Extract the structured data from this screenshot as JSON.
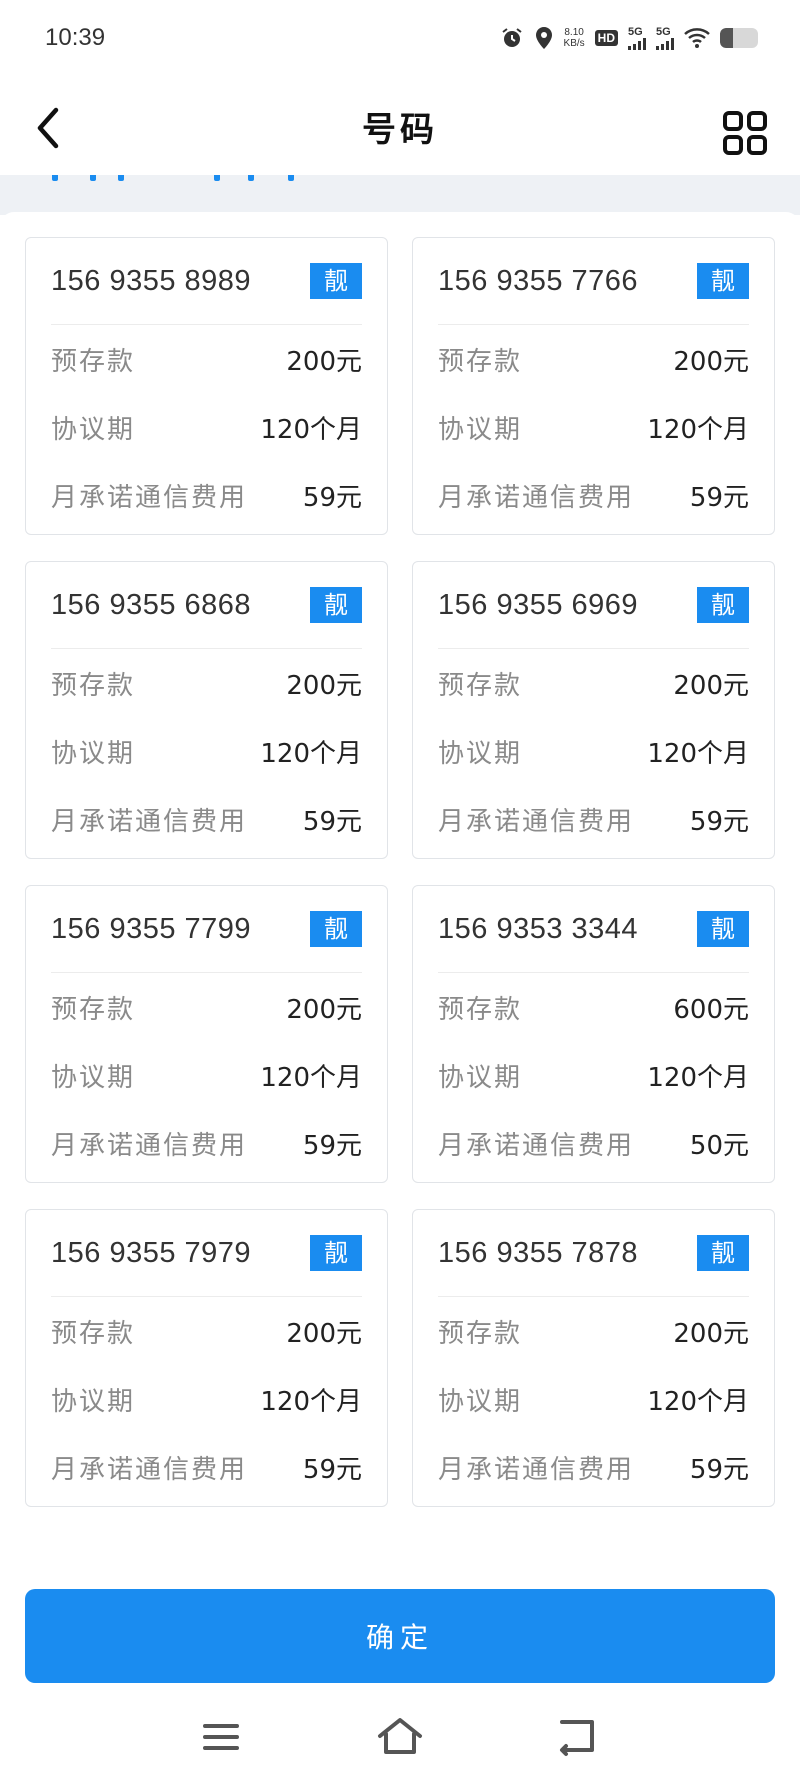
{
  "status_bar": {
    "time": "10:39",
    "net_speed_value": "8.10",
    "net_speed_unit": "KB/s",
    "hd_label": "HD",
    "signal1_label": "5G",
    "signal2_label": "5G",
    "battery_level": 0.35,
    "icons": [
      "alarm-icon",
      "location-icon",
      "wifi-icon",
      "battery-icon"
    ]
  },
  "header": {
    "title": "号码",
    "back_icon": "chevron-left-icon",
    "menu_icon": "grid-icon"
  },
  "labels": {
    "deposit": "预存款",
    "term": "协议期",
    "monthly": "月承诺通信费用"
  },
  "numbers": [
    {
      "phone": "156 9355 8989",
      "badge": "靓",
      "deposit": "200元",
      "term": "120个月",
      "monthly": "59元"
    },
    {
      "phone": "156 9355 7766",
      "badge": "靓",
      "deposit": "200元",
      "term": "120个月",
      "monthly": "59元"
    },
    {
      "phone": "156 9355 6868",
      "badge": "靓",
      "deposit": "200元",
      "term": "120个月",
      "monthly": "59元"
    },
    {
      "phone": "156 9355 6969",
      "badge": "靓",
      "deposit": "200元",
      "term": "120个月",
      "monthly": "59元"
    },
    {
      "phone": "156 9355 7799",
      "badge": "靓",
      "deposit": "200元",
      "term": "120个月",
      "monthly": "59元"
    },
    {
      "phone": "156 9353 3344",
      "badge": "靓",
      "deposit": "600元",
      "term": "120个月",
      "monthly": "50元"
    },
    {
      "phone": "156 9355 7979",
      "badge": "靓",
      "deposit": "200元",
      "term": "120个月",
      "monthly": "59元"
    },
    {
      "phone": "156 9355 7878",
      "badge": "靓",
      "deposit": "200元",
      "term": "120个月",
      "monthly": "59元"
    }
  ],
  "confirm_label": "确定",
  "colors": {
    "accent": "#1a8cf0",
    "label_text": "#8a8a8a",
    "card_border": "#e1e4e8"
  },
  "nav_icons": [
    "menu-icon",
    "home-icon",
    "back-icon"
  ]
}
